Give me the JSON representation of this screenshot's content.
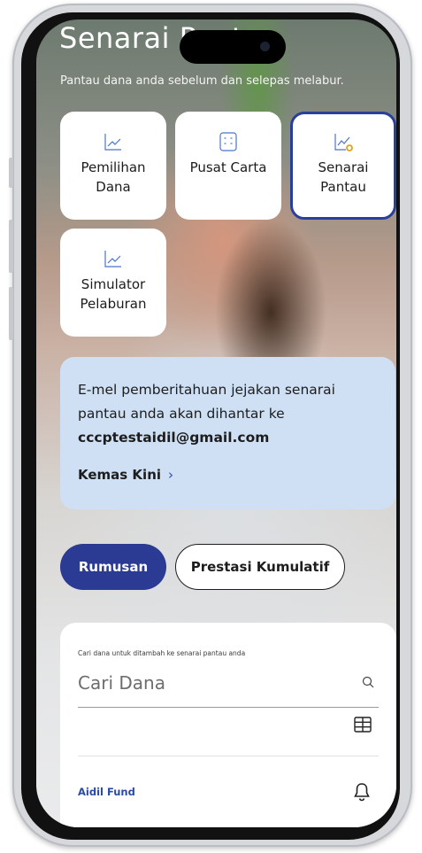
{
  "header": {
    "title": "Senarai Pantau",
    "subtitle": "Pantau dana anda sebelum dan selepas melabur."
  },
  "menu": {
    "tiles": [
      {
        "label": "Pemilihan Dana",
        "icon": "line-chart-icon",
        "active": false
      },
      {
        "label": "Pusat Carta",
        "icon": "grid-chart-icon",
        "active": false
      },
      {
        "label": "Senarai Pantau",
        "icon": "watchlist-chart-icon",
        "active": true
      },
      {
        "label": "Simulator Pelaburan",
        "icon": "line-chart-icon",
        "active": false
      }
    ]
  },
  "notice": {
    "text": "E-mel pemberitahuan jejakan senarai pantau anda akan dihantar ke",
    "email": "cccptestaidil@gmail.com",
    "link_label": "Kemas Kini",
    "link_icon": "chevron-right-icon"
  },
  "tabs": {
    "summary_label": "Rumusan",
    "cumulative_label": "Prestasi Kumulatif",
    "selected": "Rumusan"
  },
  "search": {
    "hint": "Cari dana untuk ditambah ke senarai pantau anda",
    "placeholder": "Cari Dana",
    "value": ""
  },
  "watchlist": {
    "items": [
      {
        "name": "Aidil Fund",
        "icon": "bell-icon"
      }
    ]
  },
  "colors": {
    "accent": "#2b3a93",
    "active_border": "#2a3f9a",
    "notice_bg": "#cfe0f5",
    "link": "#2a4aa8"
  }
}
